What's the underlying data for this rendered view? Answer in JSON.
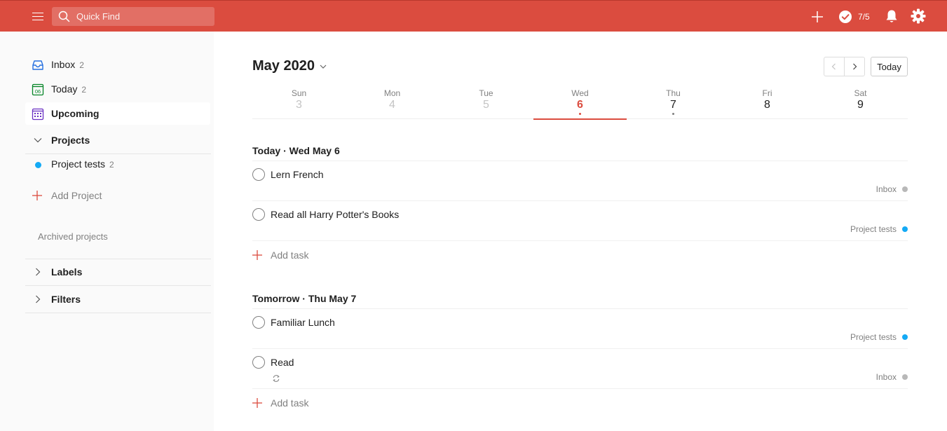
{
  "colors": {
    "brand": "#db4c3f",
    "inbox_dot": "#b8b8b8",
    "project_tests_dot": "#14aaf5",
    "inbox_icon": "#246fe0",
    "today_icon": "#058527",
    "upcoming_icon": "#692fc2"
  },
  "topbar": {
    "search_placeholder": "Quick Find",
    "karma": "7/5",
    "icons": [
      "menu-icon",
      "search-icon",
      "plus-icon",
      "karma-check-icon",
      "bell-icon",
      "gear-icon"
    ]
  },
  "sidebar": {
    "inbox": {
      "label": "Inbox",
      "count": "2"
    },
    "today": {
      "label": "Today",
      "count": "2",
      "icon_day": "06"
    },
    "upcoming": {
      "label": "Upcoming"
    },
    "projects_header": "Projects",
    "projects": [
      {
        "label": "Project tests",
        "count": "2"
      }
    ],
    "add_project": "Add Project",
    "archived": "Archived projects",
    "labels_header": "Labels",
    "filters_header": "Filters"
  },
  "main": {
    "month": "May 2020",
    "today_button": "Today",
    "week": [
      {
        "name": "Sun",
        "date": "3",
        "state": "past"
      },
      {
        "name": "Mon",
        "date": "4",
        "state": "past"
      },
      {
        "name": "Tue",
        "date": "5",
        "state": "past"
      },
      {
        "name": "Wed",
        "date": "6",
        "state": "current"
      },
      {
        "name": "Thu",
        "date": "7",
        "state": "future"
      },
      {
        "name": "Fri",
        "date": "8",
        "state": "future"
      },
      {
        "name": "Sat",
        "date": "9",
        "state": "future"
      }
    ],
    "groups": [
      {
        "title": "Today · Wed May 6",
        "tasks": [
          {
            "name": "Lern French",
            "project": "Inbox"
          },
          {
            "name": "Read all Harry Potter's Books",
            "project": "Project tests"
          }
        ],
        "add_task": "Add task"
      },
      {
        "title": "Tomorrow · Thu May 7",
        "tasks": [
          {
            "name": "Familiar Lunch",
            "project": "Project tests"
          },
          {
            "name": "Read",
            "project": "Inbox"
          }
        ],
        "add_task": "Add task"
      }
    ]
  }
}
